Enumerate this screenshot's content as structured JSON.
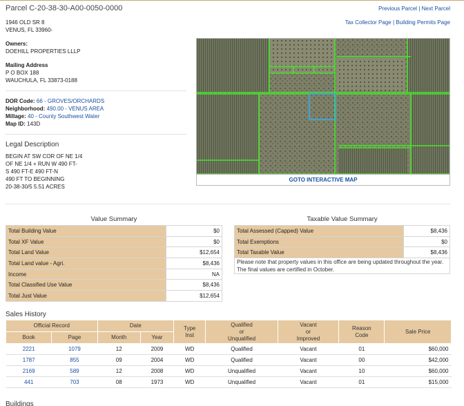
{
  "header": {
    "title": "Parcel C-20-38-30-A00-0050-0000",
    "prev_parcel": "Previous Parcel",
    "next_parcel": "Next Parcel",
    "separator": "|",
    "tax_collector": "Tax Collector Page",
    "building_permits": "Building Permits Page"
  },
  "property": {
    "address_line1": "1946 OLD SR 8",
    "address_line2": "VENUS, FL 33960-",
    "owners_label": "Owners:",
    "owner": "DOEHILL PROPERTIES LLLP",
    "mailing_label": "Mailing Address",
    "mailing_line1": "P O BOX 188",
    "mailing_line2": "WAUCHULA, FL 33873-0188",
    "dor_label": "DOR Code:",
    "dor_value": "66 - GROVES/ORCHARDS",
    "neighborhood_label": "Neighborhood:",
    "neighborhood_value": "490.00 - VENUS AREA",
    "millage_label": "Millage:",
    "millage_value": "40 - County Southwest Water",
    "mapid_label": "Map ID:",
    "mapid_value": "143D"
  },
  "legal": {
    "title": "Legal Description",
    "lines": [
      "BEGIN AT SW COR OF NE 1/4",
      "OF NE 1/4 + RUN W 490 FT-",
      "S 490 FT-E 490 FT-N",
      "490 FT TO BEGINNING",
      "20-38-30/5 5.51 ACRES"
    ]
  },
  "map": {
    "goto_label": "GOTO INTERACTIVE MAP"
  },
  "value_summary": {
    "title": "Value Summary",
    "rows": [
      {
        "label": "Total Building Value",
        "value": "$0"
      },
      {
        "label": "Total XF Value",
        "value": "$0"
      },
      {
        "label": "Total Land Value",
        "value": "$12,654"
      },
      {
        "label": "Total Land value - Agri.",
        "value": "$8,436"
      },
      {
        "label": "Income",
        "value": "NA"
      },
      {
        "label": "Total Classified Use Value",
        "value": "$8,436"
      },
      {
        "label": "Total Just Value",
        "value": "$12,654"
      }
    ]
  },
  "taxable_summary": {
    "title": "Taxable Value Summary",
    "rows": [
      {
        "label": "Total Assessed (Capped) Value",
        "value": "$8,436"
      },
      {
        "label": "Total Exemptions",
        "value": "$0"
      },
      {
        "label": "Total Taxable Value",
        "value": "$8,436"
      }
    ],
    "note_line1": "Please note that property values in this office are being updated throughout the year.",
    "note_line2": "The final values are certified in October."
  },
  "sales_history": {
    "title": "Sales History",
    "headers": {
      "official_record": "Official Record",
      "date": "Date",
      "type_inst_1": "Type",
      "type_inst_2": "Inst",
      "qual_1": "Qualified",
      "qual_2": "or",
      "qual_3": "Unqualified",
      "vacant_1": "Vacant",
      "vacant_2": "or",
      "vacant_3": "Improved",
      "reason_1": "Reason",
      "reason_2": "Code",
      "sale_price": "Sale Price",
      "book": "Book",
      "page": "Page",
      "month": "Month",
      "year": "Year"
    },
    "rows": [
      {
        "book": "2221",
        "page": "1079",
        "month": "12",
        "year": "2009",
        "type": "WD",
        "qual": "Qualified",
        "vacant": "Vacant",
        "reason": "01",
        "price": "$60,000"
      },
      {
        "book": "1787",
        "page": "855",
        "month": "09",
        "year": "2004",
        "type": "WD",
        "qual": "Qualified",
        "vacant": "Vacant",
        "reason": "00",
        "price": "$42,000"
      },
      {
        "book": "2169",
        "page": "589",
        "month": "12",
        "year": "2008",
        "type": "WD",
        "qual": "Unqualified",
        "vacant": "Vacant",
        "reason": "10",
        "price": "$60,000"
      },
      {
        "book": "441",
        "page": "703",
        "month": "08",
        "year": "1973",
        "type": "WD",
        "qual": "Unqualified",
        "vacant": "Vacant",
        "reason": "01",
        "price": "$15,000"
      }
    ]
  },
  "buildings": {
    "title": "Buildings"
  }
}
